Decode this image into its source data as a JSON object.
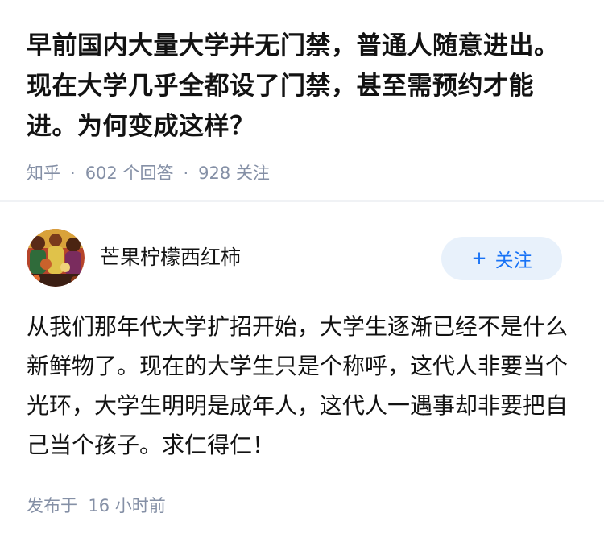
{
  "question": {
    "title": "早前国内大量大学并无门禁，普通人随意进出。现在大学几乎全都设了门禁，甚至需预约才能进。为何变成这样？",
    "source": "知乎",
    "separator": "·",
    "answers_count": "602",
    "answers_label": "个回答",
    "followers_count": "928",
    "followers_label": "关注"
  },
  "answer": {
    "author": {
      "name": "芒果柠檬西红柿",
      "avatar_icon": "colorful-crowd-avatar"
    },
    "follow_button": {
      "plus": "+",
      "label": "关注"
    },
    "content": "从我们那年代大学扩招开始，大学生逐渐已经不是什么新鲜物了。现在的大学生只是个称呼，这代人非要当个光环，大学生明明是成年人，这代人一遇事却非要把自己当个孩子。求仁得仁！",
    "published_label": "发布于",
    "published_time": "16 小时前"
  },
  "colors": {
    "primary_text": "#121212",
    "meta_text": "#8590a6",
    "follow_text": "#1772f6",
    "follow_bg": "#e8f1fb",
    "divider": "#f0f2f5"
  }
}
